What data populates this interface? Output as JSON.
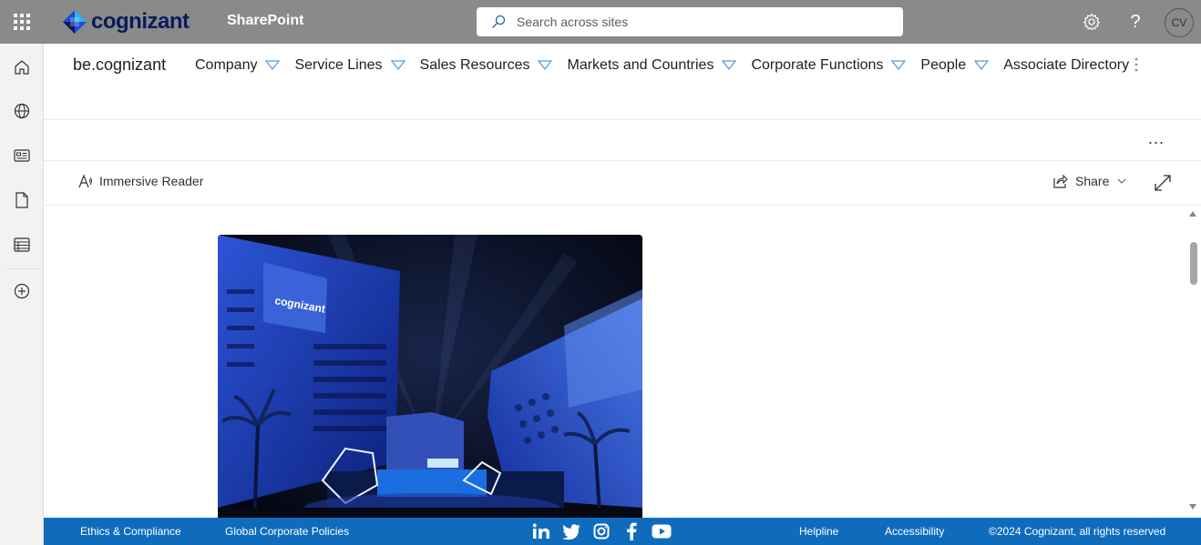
{
  "suite_bar": {
    "brand_name": "cognizant",
    "app_name": "SharePoint",
    "search_placeholder": "Search across sites",
    "avatar_initials": "CV",
    "background": "#8a8a8a"
  },
  "site": {
    "title": "be.cognizant",
    "nav": [
      {
        "label": "Company",
        "has_dropdown": true
      },
      {
        "label": "Service Lines",
        "has_dropdown": true
      },
      {
        "label": "Sales Resources",
        "has_dropdown": true
      },
      {
        "label": "Markets and Countries",
        "has_dropdown": true
      },
      {
        "label": "Corporate Functions",
        "has_dropdown": true
      },
      {
        "label": "People",
        "has_dropdown": true
      },
      {
        "label": "Associate Directory",
        "has_dropdown": false
      }
    ]
  },
  "commands": {
    "more_label": "...",
    "immersive_reader": "Immersive Reader",
    "share": "Share"
  },
  "hero_image": {
    "sign_text": "cognizant"
  },
  "footer": {
    "background": "#0f6cbd",
    "links_left": [
      "Ethics & Compliance",
      "Global Corporate Policies"
    ],
    "social": [
      "linkedin-icon",
      "twitter-icon",
      "instagram-icon",
      "facebook-icon",
      "youtube-icon"
    ],
    "links_right": [
      "Helpline",
      "Accessibility"
    ],
    "copyright": "©2024 Cognizant, all rights reserved"
  }
}
